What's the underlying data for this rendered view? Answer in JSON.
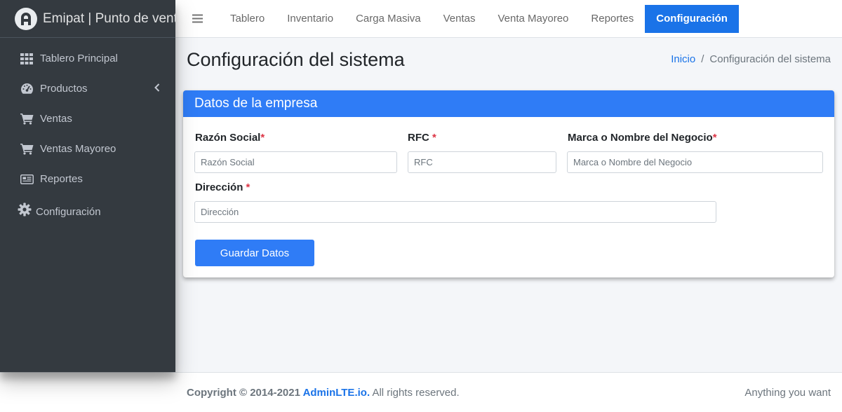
{
  "brand": {
    "name": "Emipat | Punto de venta",
    "logo_icon": "letter-a-icon"
  },
  "sidebar": {
    "items": [
      {
        "label": "Tablero Principal",
        "icon": "grid-icon"
      },
      {
        "label": "Productos",
        "icon": "dashboard-gauge-icon",
        "expand_icon": "chevron-left-icon"
      },
      {
        "label": "Ventas",
        "icon": "cart-icon"
      },
      {
        "label": "Ventas Mayoreo",
        "icon": "cart-icon"
      },
      {
        "label": "Reportes",
        "icon": "newspaper-icon"
      },
      {
        "label": "Configuración",
        "icon": "gear-icon"
      }
    ]
  },
  "topnav": {
    "menu_icon": "hamburger-icon",
    "links": [
      "Tablero",
      "Inventario",
      "Carga Masiva",
      "Ventas",
      "Venta Mayoreo",
      "Reportes",
      "Configuración"
    ],
    "active": "Configuración"
  },
  "page": {
    "title": "Configuración del sistema",
    "breadcrumb": {
      "home": "Inicio",
      "separator": "/",
      "current": "Configuración del sistema"
    }
  },
  "form": {
    "header": "Datos de la empresa",
    "fields": {
      "razon_social": {
        "label": "Razón Social",
        "required_mark": "*",
        "placeholder": "Razón Social",
        "value": ""
      },
      "rfc": {
        "label": "RFC ",
        "required_mark": "*",
        "placeholder": "RFC",
        "value": ""
      },
      "marca": {
        "label": "Marca o Nombre del Negocio",
        "required_mark": "*",
        "placeholder": "Marca o Nombre del Negocio",
        "value": ""
      },
      "direccion": {
        "label": "Dirección ",
        "required_mark": "*",
        "placeholder": "Dirección",
        "value": ""
      }
    },
    "submit_label": "Guardar Datos"
  },
  "footer": {
    "copyright": "Copyright © 2014-2021 ",
    "link": "AdminLTE.io.",
    "rights": " All rights reserved.",
    "right_text": "Anything you want"
  },
  "colors": {
    "sidebar_bg": "#343a40",
    "primary": "#2f7cf6",
    "active_nav": "#1a73e8",
    "required": "#dc3545",
    "content_bg": "#f4f6f9"
  }
}
